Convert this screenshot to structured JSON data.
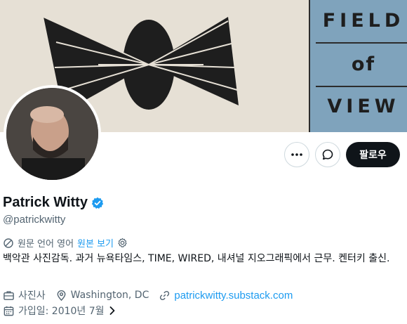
{
  "banner": {
    "book_line1": "FIELD",
    "book_line2": "of",
    "book_line3": "VIEW"
  },
  "actions": {
    "more_icon": "more-dots-icon",
    "message_icon": "message-icon",
    "follow_label": "팔로우"
  },
  "profile": {
    "name": "Patrick Witty",
    "verified_icon": "verified-badge-icon",
    "handle": "@patrickwitty",
    "translate_note": "원문 언어 영어",
    "translate_link": "원본 보기",
    "bio": "백악관 사진감독. 과거 뉴욕타임스, TIME, WIRED, 내셔널 지오그래픽에서 근무. 켄터키 출신.",
    "profession": "사진사",
    "location": "Washington, DC",
    "website": "patrickwitty.substack.com",
    "joined": "가입일: 2010년 7월"
  },
  "colors": {
    "accent": "#1d9bf0",
    "follow_bg": "#0f1419",
    "secondary_text": "#536471",
    "banner_bg": "#e6e0d5",
    "book_cover": "#7fa3bc"
  }
}
